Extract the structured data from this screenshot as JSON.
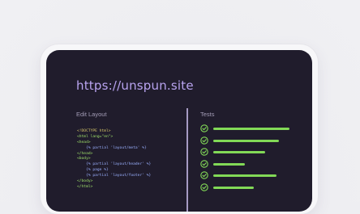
{
  "browser": {
    "url": "https://unspun.site"
  },
  "editor": {
    "title": "Edit Layout",
    "lines": [
      {
        "text": "<!DOCTYPE html>",
        "kind": "doctype"
      },
      {
        "text": "<html lang=\"en\">",
        "kind": "tag"
      },
      {
        "text": "<head>",
        "kind": "tag"
      },
      {
        "text": "    {% partial 'layout/meta' %}",
        "kind": "tpl"
      },
      {
        "text": "</head>",
        "kind": "tag"
      },
      {
        "text": "<body>",
        "kind": "tag"
      },
      {
        "text": "    {% partial 'layout/header' %}",
        "kind": "tpl"
      },
      {
        "text": "    {% page %}",
        "kind": "tpl"
      },
      {
        "text": "    {% partial 'layout/footer' %}",
        "kind": "tpl"
      },
      {
        "text": "</body>",
        "kind": "tag"
      },
      {
        "text": "</html>",
        "kind": "tag"
      }
    ]
  },
  "tests": {
    "title": "Tests",
    "items": [
      {
        "status": "check-icon",
        "progress": 1.0
      },
      {
        "status": "check-icon",
        "progress": 0.86
      },
      {
        "status": "check-icon",
        "progress": 0.68
      },
      {
        "status": "check-icon",
        "progress": 0.42
      },
      {
        "status": "check-icon",
        "progress": 0.83
      },
      {
        "status": "check-icon",
        "progress": 0.53
      }
    ]
  },
  "colors": {
    "screen_bg": "#201c2c",
    "url": "#b9a4f0",
    "success": "#82d957"
  }
}
